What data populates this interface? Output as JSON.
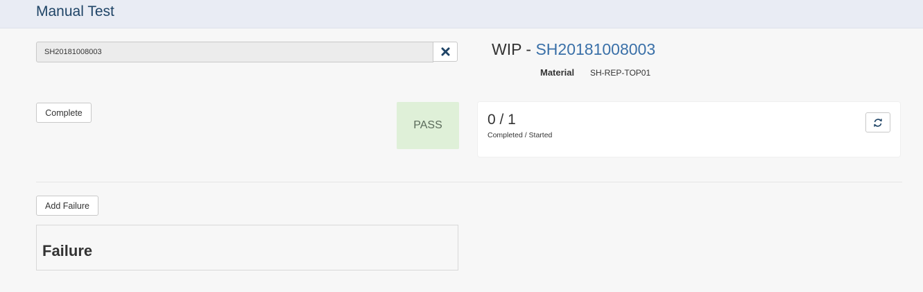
{
  "header": {
    "title": "Manual Test"
  },
  "search": {
    "value": "SH20181008003",
    "clear_icon": "close-icon"
  },
  "actions": {
    "complete_label": "Complete",
    "add_failure_label": "Add Failure"
  },
  "status": {
    "label": "PASS",
    "color": "#dff0d8"
  },
  "wip": {
    "prefix": "WIP - ",
    "id": "SH20181008003",
    "id_color": "#3a70a8"
  },
  "material": {
    "label": "Material",
    "value": "SH-REP-TOP01"
  },
  "counter": {
    "value": "0 / 1",
    "caption": "Completed / Started",
    "refresh_icon": "refresh-icon"
  },
  "failure": {
    "title": "Failure"
  },
  "colors": {
    "header_bg": "#e9ecf4",
    "title": "#1f4466",
    "page_bg": "#f7f7f7"
  }
}
